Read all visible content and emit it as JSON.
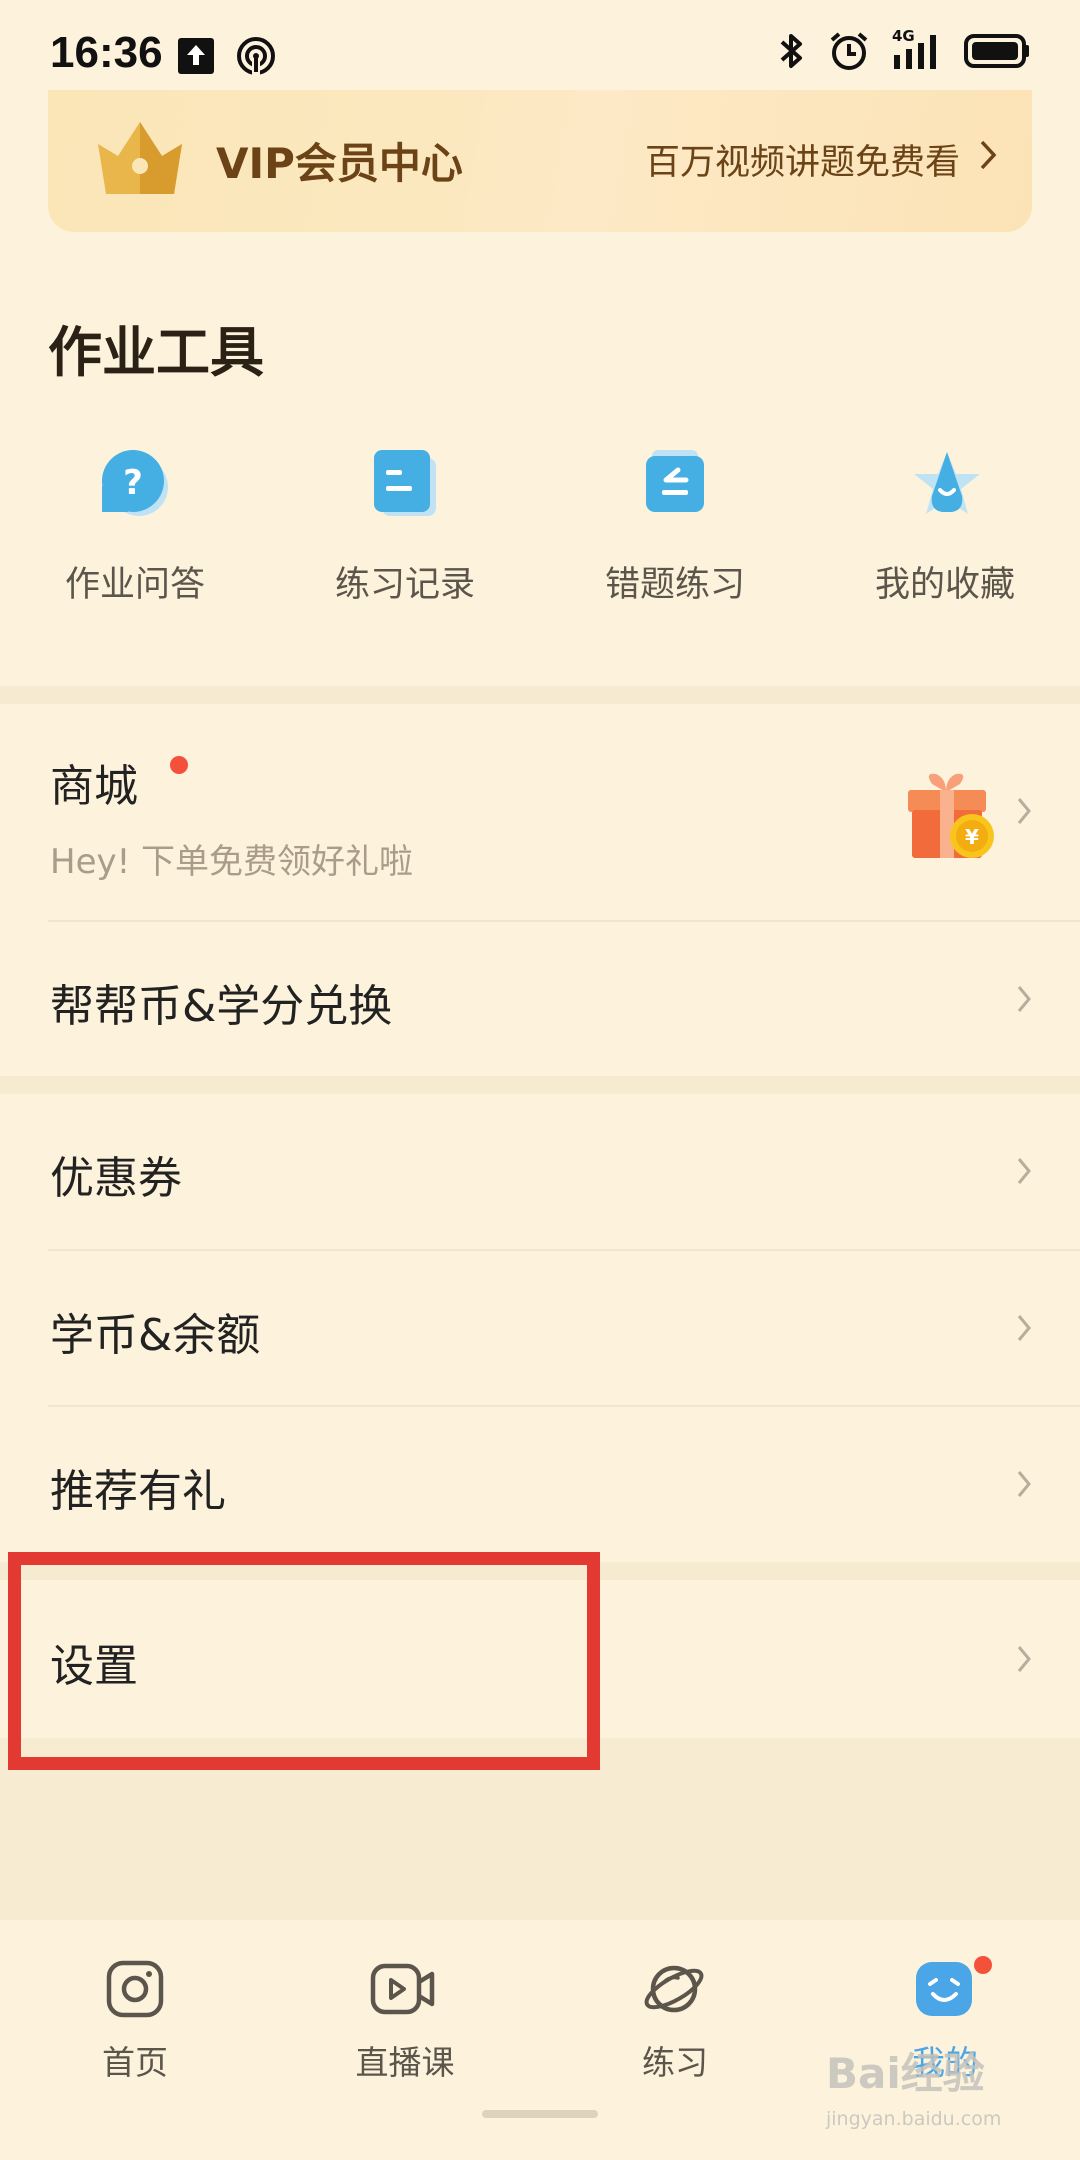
{
  "status_bar": {
    "time": "16:36",
    "network": "4G"
  },
  "vip_banner": {
    "title": "VIP会员中心",
    "subtitle": "百万视频讲题免费看"
  },
  "tools": {
    "title": "作业工具",
    "items": [
      {
        "label": "作业问答",
        "icon": "question-bubble-icon"
      },
      {
        "label": "练习记录",
        "icon": "record-note-icon"
      },
      {
        "label": "错题练习",
        "icon": "wrong-question-icon"
      },
      {
        "label": "我的收藏",
        "icon": "star-collection-icon"
      }
    ]
  },
  "mall": {
    "title": "商城",
    "subtitle": "Hey! 下单免费领好礼啦",
    "icon": "gift-coin-icon"
  },
  "menu": {
    "exchange": "帮帮币&学分兑换",
    "coupon": "优惠券",
    "balance": "学币&余额",
    "referral": "推荐有礼",
    "settings": "设置"
  },
  "bottom_nav": {
    "items": [
      {
        "label": "首页",
        "icon": "home-camera-icon"
      },
      {
        "label": "直播课",
        "icon": "live-video-icon"
      },
      {
        "label": "练习",
        "icon": "planet-icon"
      },
      {
        "label": "我的",
        "icon": "smiley-profile-icon",
        "active": true
      }
    ]
  },
  "watermark": {
    "main": "Bai经验",
    "sub": "jingyan.baidu.com"
  },
  "colors": {
    "background": "#fdf3dc",
    "accent_blue": "#4aa6e6",
    "badge_red": "#f4513a",
    "highlight_red": "#e23a32"
  }
}
